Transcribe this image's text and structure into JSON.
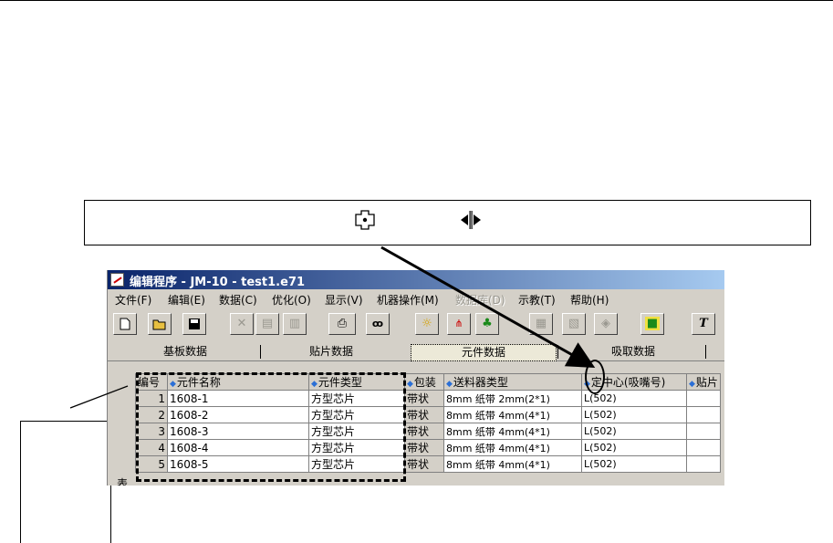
{
  "window": {
    "title": "编辑程序 - JM-10 - test1.e71"
  },
  "menu": [
    {
      "label": "文件(F)",
      "enabled": true
    },
    {
      "label": "编辑(E)",
      "enabled": true
    },
    {
      "label": "数据(C)",
      "enabled": true
    },
    {
      "label": "优化(O)",
      "enabled": true
    },
    {
      "label": "显示(V)",
      "enabled": true
    },
    {
      "label": "机器操作(M)",
      "enabled": true
    },
    {
      "label": "数据库(D)",
      "enabled": false
    },
    {
      "label": "示教(T)",
      "enabled": true
    },
    {
      "label": "帮助(H)",
      "enabled": true
    }
  ],
  "toolbar": {
    "new_icon": "new-file-icon",
    "open_icon": "open-folder-icon",
    "save_icon": "save-icon",
    "cut_icon": "cut-icon",
    "copy_icon": "copy-icon",
    "paste_icon": "paste-icon",
    "print_icon": "print-icon",
    "find_icon": "binoculars-icon",
    "text_label": "T"
  },
  "tabs": [
    {
      "label": "基板数据",
      "active": false
    },
    {
      "label": "贴片数据",
      "active": false
    },
    {
      "label": "元件数据",
      "active": true
    },
    {
      "label": "吸取数据",
      "active": false
    }
  ],
  "grid": {
    "side_label": "表",
    "columns": [
      "编号",
      "元件名称",
      "元件类型",
      "包装",
      "送料器类型",
      "定中心(吸嘴号)",
      "贴片"
    ],
    "rows": [
      {
        "no": "1",
        "name": "1608-1",
        "type": "方型芯片",
        "pack": "带状",
        "feeder": "8mm 纸带  2mm(2*1)",
        "center": "L(502)"
      },
      {
        "no": "2",
        "name": "1608-2",
        "type": "方型芯片",
        "pack": "带状",
        "feeder": "8mm 纸带  4mm(4*1)",
        "center": "L(502)"
      },
      {
        "no": "3",
        "name": "1608-3",
        "type": "方型芯片",
        "pack": "带状",
        "feeder": "8mm 纸带  4mm(4*1)",
        "center": "L(502)"
      },
      {
        "no": "4",
        "name": "1608-4",
        "type": "方型芯片",
        "pack": "带状",
        "feeder": "8mm 纸带  4mm(4*1)",
        "center": "L(502)"
      },
      {
        "no": "5",
        "name": "1608-5",
        "type": "方型芯片",
        "pack": "带状",
        "feeder": "8mm 纸带  4mm(4*1)",
        "center": "L(502)"
      }
    ]
  },
  "callout": {
    "icons": [
      "crosshair-cursor-icon",
      "column-resize-cursor-icon"
    ]
  }
}
